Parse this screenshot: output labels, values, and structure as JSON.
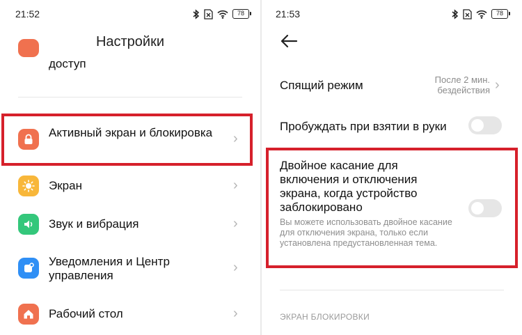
{
  "left_panel": {
    "status": {
      "time": "21:52",
      "battery": "78"
    },
    "title": "Настройки",
    "partial_item_label": "доступ",
    "items": [
      {
        "label": "Активный экран и блокировка",
        "icon": "lock-icon",
        "color": "#f0714f"
      },
      {
        "label": "Экран",
        "icon": "sun-icon",
        "color": "#f8b73a"
      },
      {
        "label": "Звук и вибрация",
        "icon": "speaker-icon",
        "color": "#34c77b"
      },
      {
        "label": "Уведомления и Центр управления",
        "icon": "notification-icon",
        "color": "#2f8ff5"
      },
      {
        "label": "Рабочий стол",
        "icon": "home-icon",
        "color": "#f0714f"
      }
    ]
  },
  "right_panel": {
    "status": {
      "time": "21:53",
      "battery": "78"
    },
    "sleep": {
      "title": "Спящий режим",
      "value": "После 2 мин. бездействия"
    },
    "raise_to_wake": {
      "title": "Пробуждать при взятии в руки"
    },
    "double_tap": {
      "title": "Двойное касание для включения и отключения экрана, когда устройство заблокировано",
      "description": "Вы можете использовать двойное касание для отключения экрана, только если установлена предустановленная тема."
    },
    "section_header": "ЭКРАН БЛОКИРОВКИ"
  },
  "highlight_color": "#d6202b"
}
